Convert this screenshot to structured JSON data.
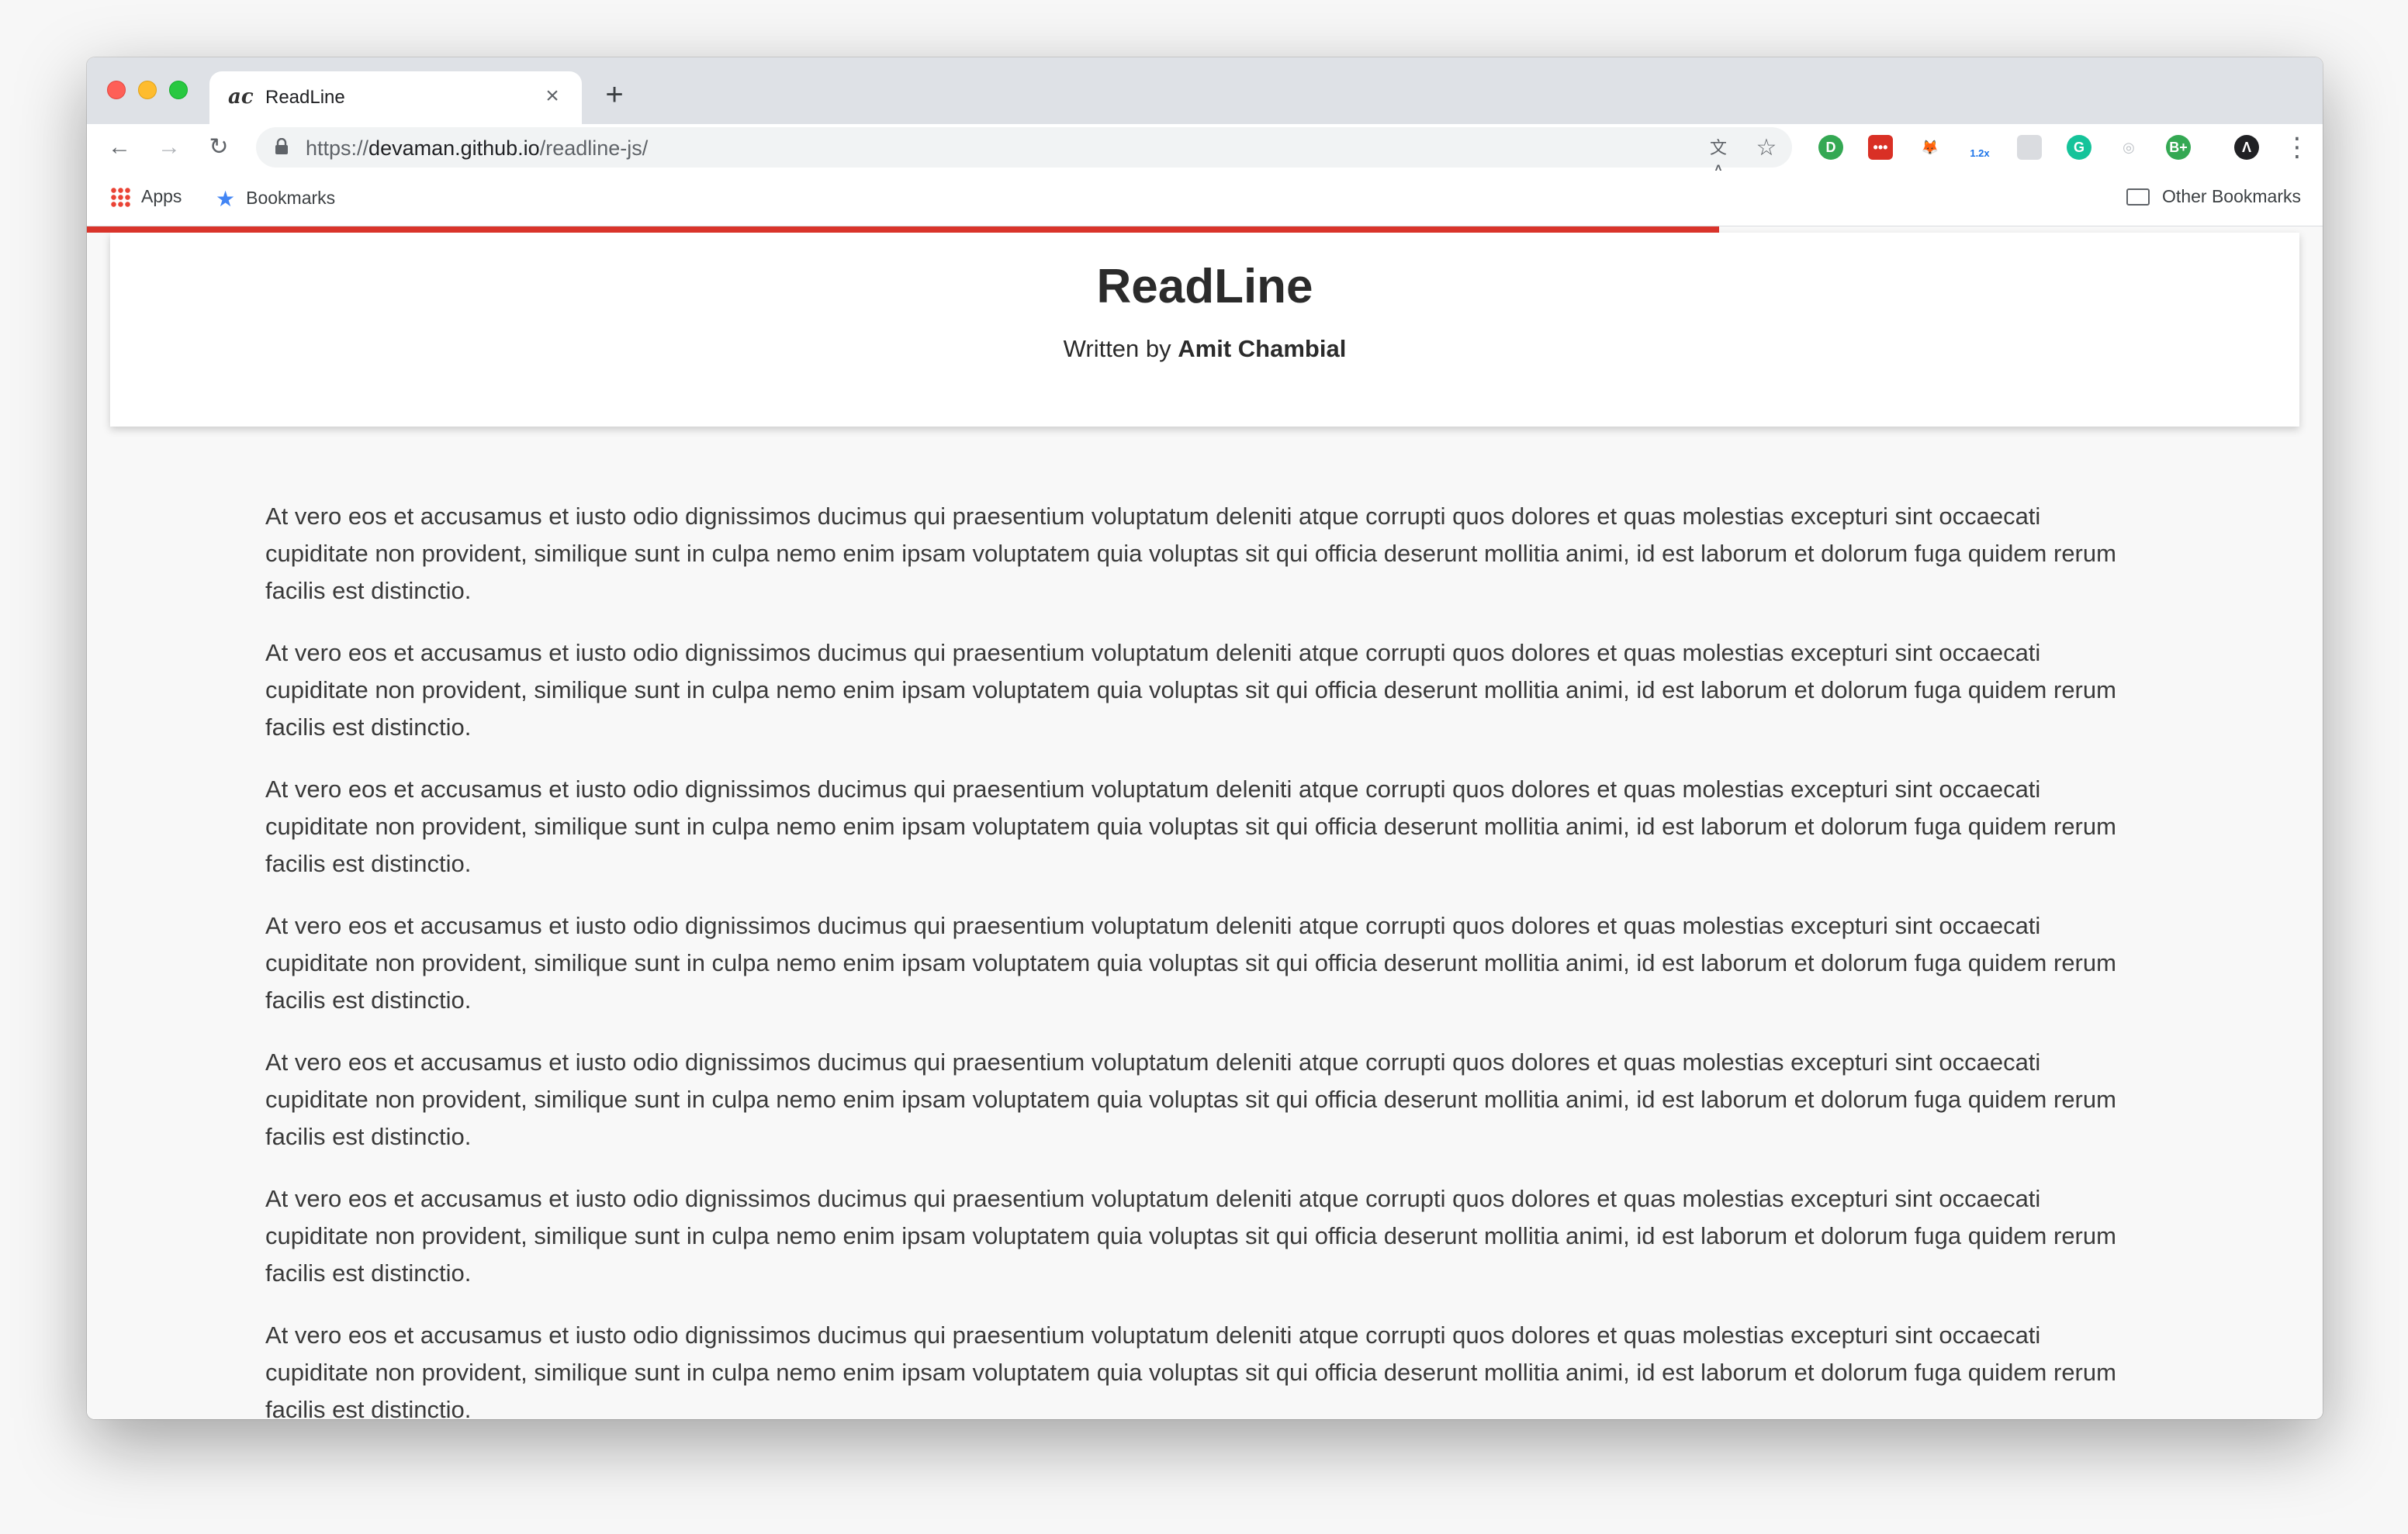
{
  "browser": {
    "tab": {
      "title": "ReadLine",
      "favicon_text": "ac",
      "close_glyph": "×"
    },
    "new_tab_glyph": "+",
    "toolbar": {
      "url_scheme": "https://",
      "url_host": "devaman.github.io",
      "url_path": "/readline-js/"
    },
    "extensions": [
      {
        "name": "extension-green-icon",
        "color": "#34a853",
        "text": "D"
      },
      {
        "name": "extension-red-icon",
        "color": "#d93025",
        "text": "•••"
      },
      {
        "name": "extension-fox-icon",
        "color": "#e8710a",
        "text": "🦊"
      },
      {
        "name": "extension-speed-icon",
        "color": "#1a73e8",
        "text": "1.2x"
      },
      {
        "name": "extension-grey-icon",
        "color": "#dadce0",
        "text": ""
      },
      {
        "name": "extension-grammarly-icon",
        "color": "#15c39a",
        "text": "G"
      },
      {
        "name": "extension-ring-icon",
        "color": "#bdc1c6",
        "text": "◎"
      },
      {
        "name": "extension-bplus-icon",
        "color": "#34a853",
        "text": "B+"
      },
      {
        "name": "extension-profile-icon",
        "color": "#202124",
        "text": "Λ"
      }
    ],
    "bookmarks": {
      "apps": "Apps",
      "bookmarks": "Bookmarks",
      "other": "Other Bookmarks"
    }
  },
  "colors": {
    "progress": "#d9342b",
    "progress_fraction": 0.73
  },
  "page": {
    "title": "ReadLine",
    "byline_prefix": "Written by",
    "author": "Amit Chambial",
    "paragraphs": [
      "At vero eos et accusamus et iusto odio dignissimos ducimus qui praesentium voluptatum deleniti atque corrupti quos dolores et quas molestias excepturi sint occaecati cupiditate non provident, similique sunt in culpa nemo enim ipsam voluptatem quia voluptas sit qui officia deserunt mollitia animi, id est laborum et dolorum fuga quidem rerum facilis est distinctio.",
      "At vero eos et accusamus et iusto odio dignissimos ducimus qui praesentium voluptatum deleniti atque corrupti quos dolores et quas molestias excepturi sint occaecati cupiditate non provident, similique sunt in culpa nemo enim ipsam voluptatem quia voluptas sit qui officia deserunt mollitia animi, id est laborum et dolorum fuga quidem rerum facilis est distinctio.",
      "At vero eos et accusamus et iusto odio dignissimos ducimus qui praesentium voluptatum deleniti atque corrupti quos dolores et quas molestias excepturi sint occaecati cupiditate non provident, similique sunt in culpa nemo enim ipsam voluptatem quia voluptas sit qui officia deserunt mollitia animi, id est laborum et dolorum fuga quidem rerum facilis est distinctio.",
      "At vero eos et accusamus et iusto odio dignissimos ducimus qui praesentium voluptatum deleniti atque corrupti quos dolores et quas molestias excepturi sint occaecati cupiditate non provident, similique sunt in culpa nemo enim ipsam voluptatem quia voluptas sit qui officia deserunt mollitia animi, id est laborum et dolorum fuga quidem rerum facilis est distinctio.",
      "At vero eos et accusamus et iusto odio dignissimos ducimus qui praesentium voluptatum deleniti atque corrupti quos dolores et quas molestias excepturi sint occaecati cupiditate non provident, similique sunt in culpa nemo enim ipsam voluptatem quia voluptas sit qui officia deserunt mollitia animi, id est laborum et dolorum fuga quidem rerum facilis est distinctio.",
      "At vero eos et accusamus et iusto odio dignissimos ducimus qui praesentium voluptatum deleniti atque corrupti quos dolores et quas molestias excepturi sint occaecati cupiditate non provident, similique sunt in culpa nemo enim ipsam voluptatem quia voluptas sit qui officia deserunt mollitia animi, id est laborum et dolorum fuga quidem rerum facilis est distinctio.",
      "At vero eos et accusamus et iusto odio dignissimos ducimus qui praesentium voluptatum deleniti atque corrupti quos dolores et quas molestias excepturi sint occaecati cupiditate non provident, similique sunt in culpa nemo enim ipsam voluptatem quia voluptas sit qui officia deserunt mollitia animi, id est laborum et dolorum fuga quidem rerum facilis est distinctio."
    ]
  }
}
